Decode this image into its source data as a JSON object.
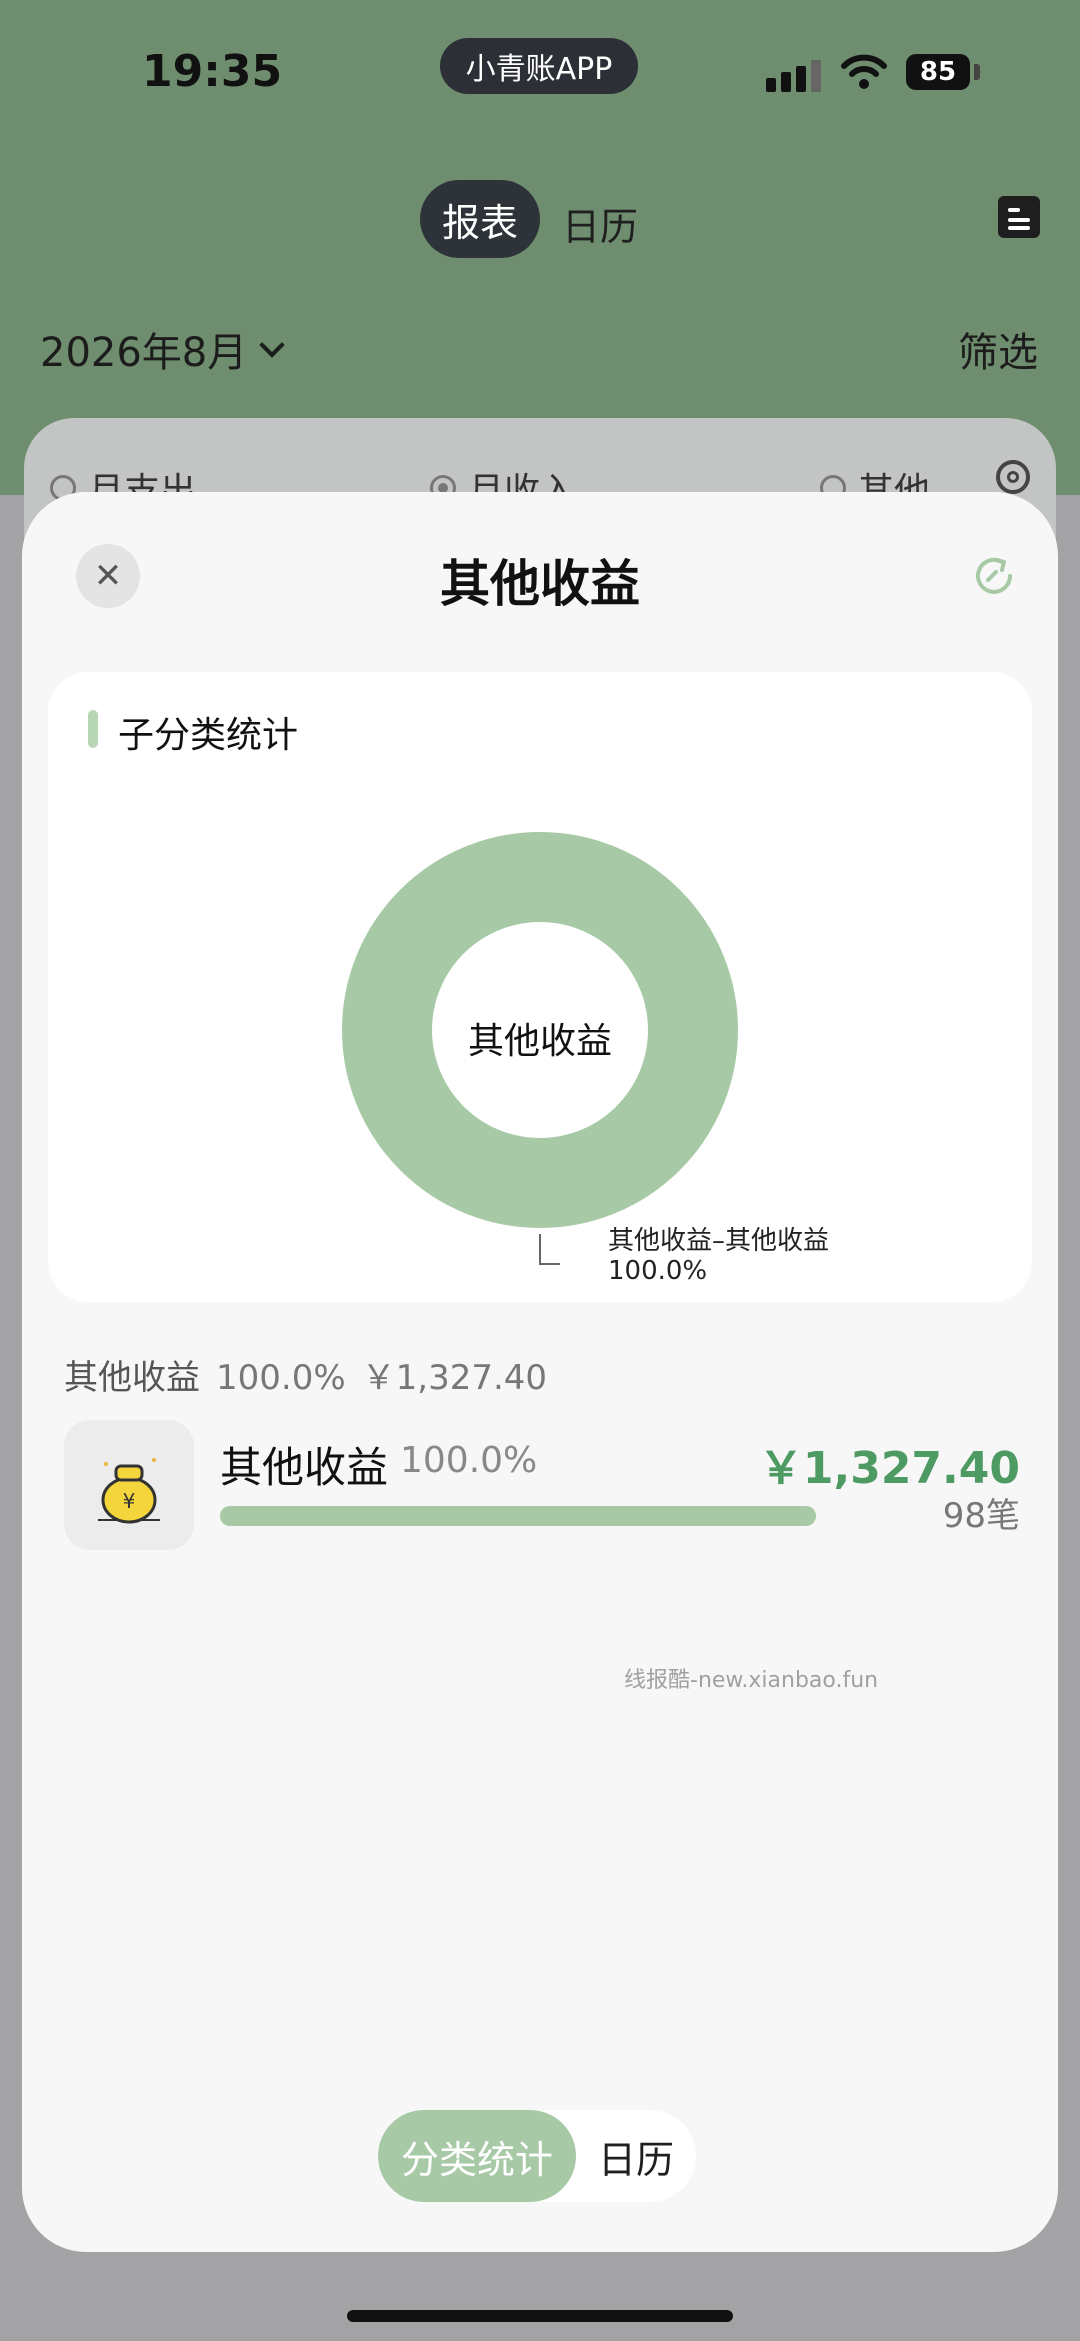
{
  "status_bar": {
    "time": "19:35",
    "app_name": "小青账APP",
    "battery": "85"
  },
  "header": {
    "tabs": [
      {
        "label": "报表",
        "active": true
      },
      {
        "label": "日历",
        "active": false
      }
    ],
    "month": "2026年8月",
    "filter_label": "筛选",
    "book_icon": "book-icon"
  },
  "type_switch": [
    {
      "label": "月支出",
      "selected": false
    },
    {
      "label": "月收入",
      "selected": true
    },
    {
      "label": "其他",
      "selected": false
    }
  ],
  "sheet": {
    "title": "其他收益",
    "close_icon": "close-icon",
    "refresh_icon": "refresh-icon",
    "chart_card": {
      "title": "子分类统计",
      "center_label": "其他收益",
      "callout_name": "其他收益–其他收益",
      "callout_pct": "100.0%"
    },
    "summary": {
      "name": "其他收益",
      "percent": "100.0%",
      "amount": "￥1,327.40"
    },
    "category": {
      "name": "其他收益",
      "percent": "100.0%",
      "amount": "￥1,327.40",
      "count": "98笔",
      "progress": 1.0,
      "icon": "money-bag-icon"
    },
    "watermark": "线报酷-new.xianbao.fun",
    "bottom_tabs": [
      {
        "label": "分类统计",
        "active": true
      },
      {
        "label": "日历",
        "active": false
      }
    ]
  },
  "colors": {
    "header_green": "#6f8d6f",
    "accent_green": "#a7c9a5",
    "amount_green": "#4e9a63"
  },
  "chart_data": {
    "type": "pie",
    "donut": true,
    "title": "子分类统计",
    "categories": [
      "其他收益–其他收益"
    ],
    "values": [
      100.0
    ],
    "labels": [
      "100.0%"
    ],
    "colors": [
      "#a7c9a5"
    ],
    "center_text": "其他收益"
  }
}
